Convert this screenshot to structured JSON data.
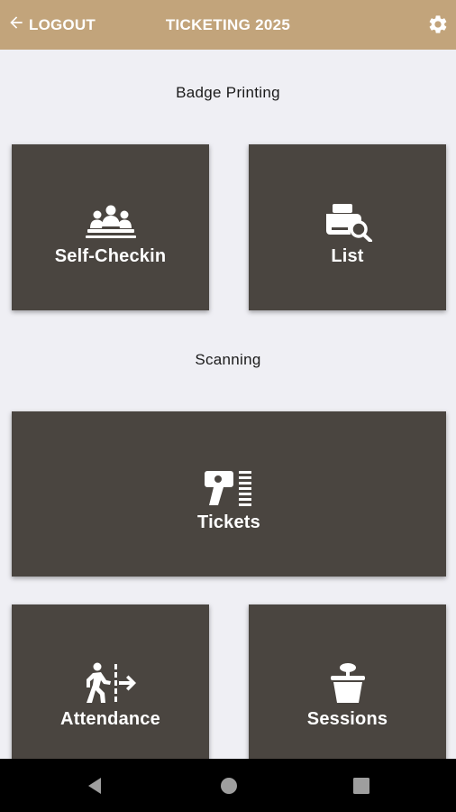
{
  "header": {
    "back_icon": "arrow-left-icon",
    "logout_label": "LOGOUT",
    "title": "TICKETING 2025",
    "settings_icon": "gear-icon",
    "background": "#c2a47b",
    "text_color": "#ffffff"
  },
  "sections": {
    "badge_printing": {
      "title": "Badge Printing",
      "tiles": [
        {
          "label": "Self-Checkin",
          "icon": "group-checkin-icon"
        },
        {
          "label": "List",
          "icon": "printer-search-icon"
        }
      ]
    },
    "scanning": {
      "title": "Scanning",
      "tiles": [
        {
          "label": "Tickets",
          "icon": "barcode-scanner-icon"
        },
        {
          "label": "Attendance",
          "icon": "person-walking-door-icon"
        },
        {
          "label": "Sessions",
          "icon": "basket-icon"
        }
      ]
    }
  },
  "colors": {
    "tile_background": "#4a4540",
    "page_background": "#efeff4"
  },
  "navbar": {
    "back_icon": "nav-back-triangle-icon",
    "home_icon": "nav-home-circle-icon",
    "recents_icon": "nav-recents-square-icon"
  }
}
